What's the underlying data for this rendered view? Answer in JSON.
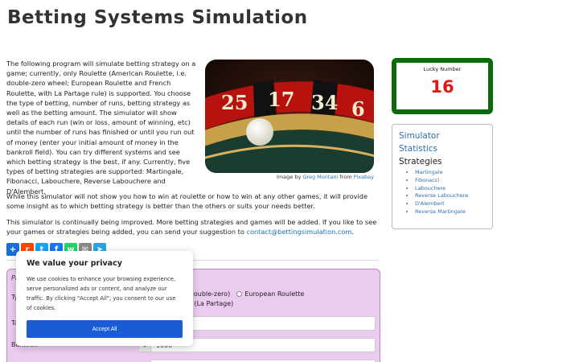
{
  "page": {
    "title": "Betting Systems Simulation"
  },
  "intro": {
    "text": "The following program will simulate betting strategy on a game; currently, only Roulette (American Roulette, i.e. double-zero wheel; European Roulette and French Roulette, with La Partage rule) is supported. You choose the type of betting, number of runs, betting strategy as well as the betting amount. The simulator will show details of each run (win or loss, amount of winning, etc) until the number of runs has finished or until you run out of money (enter your initial amount of money in the bankroll field). You can try different systems and see which betting strategy is the best, if any. Currently, five types of betting strategies are supported: Martingale, Fibonacci, Labouchere, Reverse Labouchere and D'Alembert."
  },
  "image": {
    "credit_prefix": "Image by",
    "credit_author": "Greg Montani",
    "credit_middle": "from",
    "credit_source": "Pixabay",
    "numbers": [
      "25",
      "17",
      "34",
      "6"
    ]
  },
  "paragraphs": {
    "p1": "While this simulator will not show you how to win at roulette or how to win at any other games, it will provide some insight as to which betting strategy is better than the others or suits your needs better.",
    "p2_text": "This simulator is continually being improved. More betting strategies and games will be added. If you like to see your games or strategies being added, you can send your suggestion to",
    "p2_email": "contact@bettingsimulation.com",
    "p2_end": "."
  },
  "share": {
    "buttons": [
      {
        "name": "share-add",
        "glyph": "+",
        "color": "#1a6fd6"
      },
      {
        "name": "share-reddit",
        "glyph": "r",
        "color": "#ff4500"
      },
      {
        "name": "share-twitter",
        "glyph": "t",
        "color": "#1da1f2"
      },
      {
        "name": "share-facebook",
        "glyph": "f",
        "color": "#1877f2"
      },
      {
        "name": "share-whatsapp",
        "glyph": "w",
        "color": "#25d366"
      },
      {
        "name": "share-email",
        "glyph": "✉",
        "color": "#888888"
      },
      {
        "name": "share-telegram",
        "glyph": "➤",
        "color": "#2ca5e0"
      }
    ]
  },
  "form": {
    "legend": "Pl",
    "type_label": "Ty",
    "radio1": "ette (double-zero)",
    "radio2": "European Roulette",
    "radio3": "e (La Partage)",
    "table_label": "Ta",
    "bankroll_label": "Bankroll",
    "bankroll_addon": "$",
    "bankroll_value": "1000"
  },
  "lucky": {
    "label": "Lucky Number",
    "number": "16"
  },
  "sidebar": {
    "links": [
      "Simulator",
      "Statistics"
    ],
    "strategies_heading": "Strategies",
    "strategies": [
      "Martingale",
      "Fibonacci",
      "Labouchere",
      "Reverse Labouchere",
      "D'Alembert",
      "Reverse Martingale"
    ]
  },
  "privacy": {
    "heading": "We value your privacy",
    "body": "We use cookies to enhance your browsing experience, serve personalized ads or content, and analyze our traffic. By clicking \"Accept All\", you consent to our use of cookies.",
    "accept": "Accept All"
  }
}
